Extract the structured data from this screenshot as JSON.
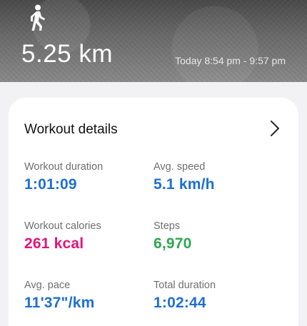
{
  "header": {
    "activity_icon": "walking-person-icon",
    "distance": "5.25 km",
    "time_range": "Today 8:54 pm - 9:57 pm"
  },
  "details": {
    "title": "Workout details",
    "chevron_icon": "chevron-right-icon",
    "stats": [
      {
        "label": "Workout duration",
        "value": "1:01:09",
        "color": "#1f6fd1"
      },
      {
        "label": "Avg. speed",
        "value": "5.1 km/h",
        "color": "#1f6fd1"
      },
      {
        "label": "Workout calories",
        "value": "261 kcal",
        "color": "#e0157a"
      },
      {
        "label": "Steps",
        "value": "6,970",
        "color": "#2ea650"
      },
      {
        "label": "Avg. pace",
        "value": "11'37\"/km",
        "color": "#1f6fd1"
      },
      {
        "label": "Total duration",
        "value": "1:02:44",
        "color": "#1f6fd1"
      }
    ]
  }
}
